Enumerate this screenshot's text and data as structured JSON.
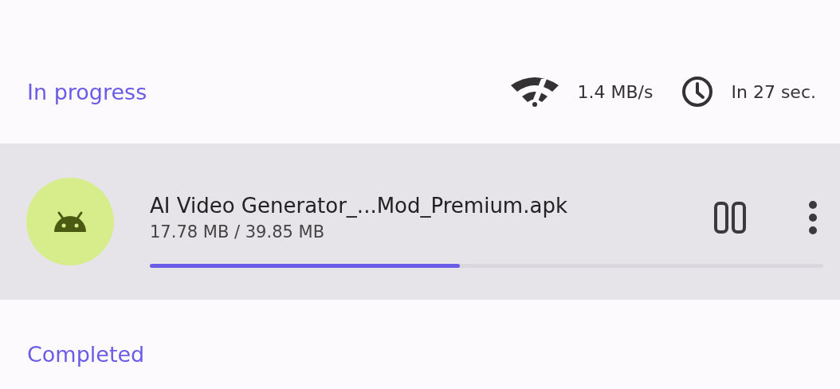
{
  "sections": [
    {
      "title": "In progress",
      "stats": [
        {
          "kind": "speed",
          "text": "1.4 MB/s"
        },
        {
          "kind": "eta",
          "text": "In 27 sec."
        }
      ],
      "items": [
        {
          "name": "AI Video Generator_...Mod_Premium.apk",
          "size": "17.78 MB / 39.85 MB",
          "level": 0.46,
          "paused": false
        }
      ]
    },
    {
      "title": "Completed"
    }
  ]
}
